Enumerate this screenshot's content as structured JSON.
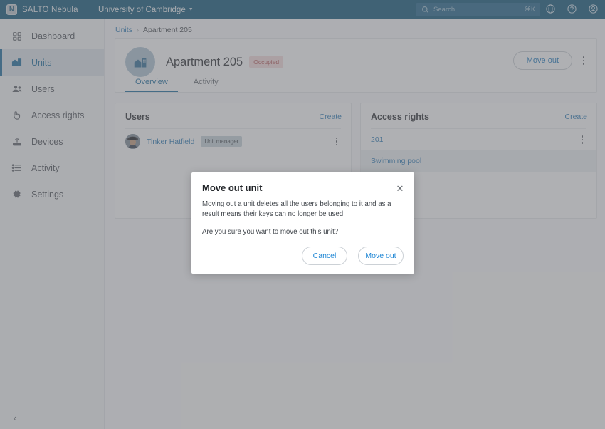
{
  "topbar": {
    "brand_initial": "N",
    "brand_name": "SALTO Nebula",
    "organization": "University of Cambridge",
    "search_placeholder": "Search",
    "search_shortcut": "⌘K",
    "icons": [
      "globe-icon",
      "help-icon",
      "account-icon"
    ]
  },
  "sidebar": {
    "items": [
      {
        "label": "Dashboard",
        "icon": "dashboard-icon",
        "active": false
      },
      {
        "label": "Units",
        "icon": "units-icon",
        "active": true
      },
      {
        "label": "Users",
        "icon": "users-icon",
        "active": false
      },
      {
        "label": "Access rights",
        "icon": "access-rights-icon",
        "active": false
      },
      {
        "label": "Devices",
        "icon": "devices-icon",
        "active": false
      },
      {
        "label": "Activity",
        "icon": "activity-icon",
        "active": false
      },
      {
        "label": "Settings",
        "icon": "settings-icon",
        "active": false
      }
    ],
    "collapse_label": "‹"
  },
  "breadcrumb": {
    "root": "Units",
    "separator": "›",
    "current": "Apartment 205"
  },
  "hero": {
    "title": "Apartment 205",
    "status_badge": "Occupied",
    "move_out_button": "Move out",
    "tabs": [
      {
        "label": "Overview",
        "active": true
      },
      {
        "label": "Activity",
        "active": false
      }
    ]
  },
  "users_panel": {
    "title": "Users",
    "create_label": "Create",
    "rows": [
      {
        "name": "Tinker Hatfield",
        "role_badge": "Unit manager"
      }
    ]
  },
  "access_rights_panel": {
    "title": "Access rights",
    "create_label": "Create",
    "rows": [
      {
        "name": "201",
        "hovered": false
      },
      {
        "name": "Swimming pool",
        "hovered": true
      }
    ]
  },
  "modal": {
    "title": "Move out unit",
    "close_label": "✕",
    "paragraph_1": "Moving out a unit deletes all the users belonging to it and as a result means their keys can no longer be used.",
    "paragraph_2": "Are you sure you want to move out this unit?",
    "cancel_label": "Cancel",
    "confirm_label": "Move out"
  },
  "colors": {
    "topbar_bg": "#0b5377",
    "accent_blue": "#16699b",
    "link_blue": "#2878b4",
    "button_blue": "#1e86d4",
    "badge_occupied_bg": "#f6dcdc",
    "badge_occupied_text": "#b04a4a",
    "badge_role_bg": "#c6d2da",
    "sidebar_bg": "#f7f8f9",
    "sidebar_active_bg": "#dde5eb"
  }
}
